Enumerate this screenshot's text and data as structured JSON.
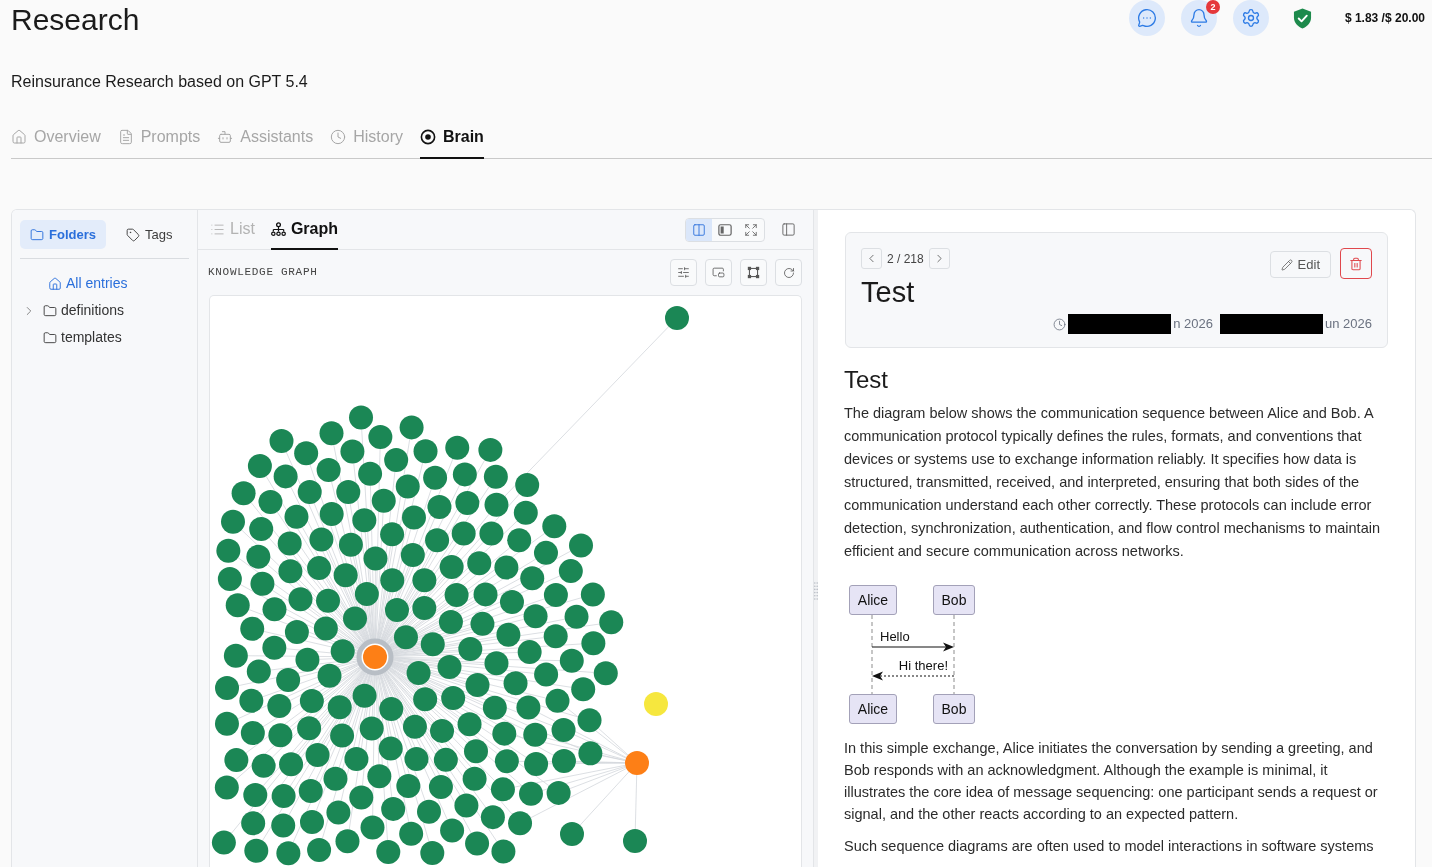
{
  "header": {
    "title": "Research",
    "subtitle": "Reinsurance Research based on GPT 5.4",
    "notification_count": "2",
    "budget": "$ 1.83 /$ 20.00"
  },
  "tabs": [
    {
      "label": "Overview",
      "selected": false
    },
    {
      "label": "Prompts",
      "selected": false
    },
    {
      "label": "Assistants",
      "selected": false
    },
    {
      "label": "History",
      "selected": false
    },
    {
      "label": "Brain",
      "selected": true
    }
  ],
  "sidebar": {
    "tabs": [
      {
        "label": "Folders",
        "selected": true
      },
      {
        "label": "Tags",
        "selected": false
      }
    ],
    "items": [
      {
        "kind": "root",
        "label": "All entries",
        "selected": true
      },
      {
        "kind": "folder",
        "label": "definitions",
        "selected": false,
        "expanded": false
      },
      {
        "kind": "folder",
        "label": "templates",
        "selected": false
      }
    ]
  },
  "view_tabs": [
    {
      "label": "List",
      "selected": false
    },
    {
      "label": "Graph",
      "selected": true
    }
  ],
  "layout_modes": [
    {
      "selected": true
    },
    {
      "selected": false
    },
    {
      "selected": false
    }
  ],
  "graph": {
    "heading": "KNOWLEDGE GRAPH"
  },
  "entry": {
    "counter": "2 / 218",
    "title": "Test",
    "edit_label": "Edit",
    "dates": [
      "n 2026",
      "un 2026"
    ]
  },
  "article": {
    "heading": "Test",
    "intro": "The diagram below shows the communication sequence between Alice and Bob. A communication protocol typically defines the rules, formats, and conventions that devices or systems use to exchange information reliably. It specifies how data is structured, transmitted, received, and interpreted, ensuring that both sides of the communication understand each other correctly. These protocols can include error detection, synchronization, authentication, and flow control mechanisms to maintain efficient and secure communication across networks.",
    "diagram": {
      "participants_top": [
        "Alice",
        "Bob"
      ],
      "messages": [
        {
          "kind": "request",
          "text": "Hello"
        },
        {
          "kind": "reply",
          "text": "Hi there!"
        }
      ],
      "participants_bottom": [
        "Alice",
        "Bob"
      ]
    },
    "paragraphs": [
      "In this simple exchange, Alice initiates the conversation by sending a greeting, and Bob responds with an acknowledgment. Although the example is minimal, it illustrates the core idea of message sequencing: one participant sends a request or signal, and the other reacts according to an expected pattern.",
      "Such sequence diagrams are often used to model interactions in software systems"
    ]
  }
}
